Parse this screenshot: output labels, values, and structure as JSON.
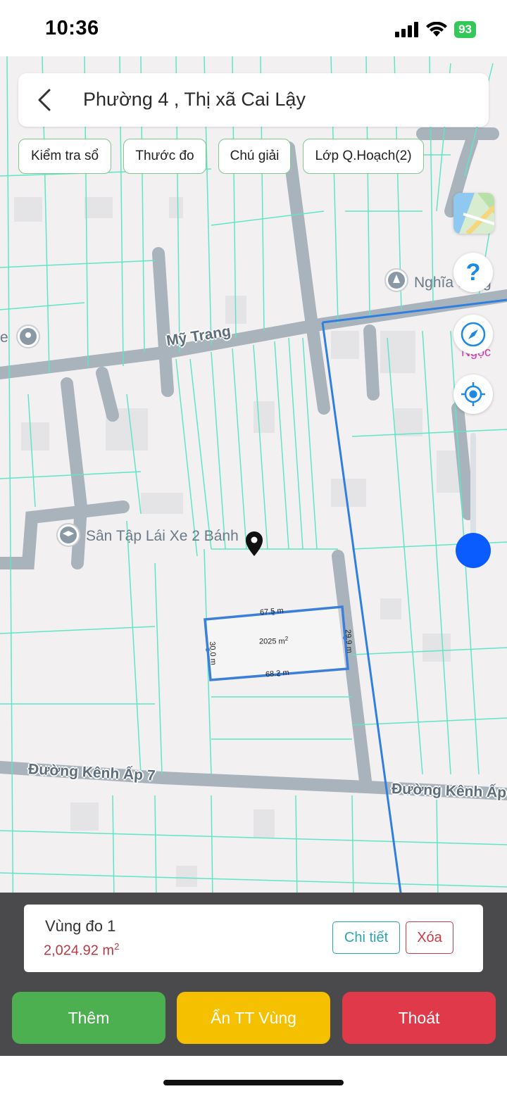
{
  "status_bar": {
    "time": "10:36",
    "battery": "93"
  },
  "header": {
    "title": "Phường 4 , Thị xã Cai Lậy"
  },
  "toolbar": {
    "check_book": "Kiểm tra sổ",
    "ruler": "Thước đo",
    "legend": "Chú giải",
    "planning_layer": "Lớp Q.Hoạch(2)"
  },
  "map": {
    "roads": {
      "my_trang": "Mỹ Trang",
      "kenh_ap_7_left": "Đường Kênh Ấp 7",
      "kenh_ap_7_right": "Đường Kênh Ấp"
    },
    "pois": {
      "driving_school": "Sân Tập Lái Xe 2 Bánh",
      "cemetery": "Nghĩa trang",
      "right_partial": "Ngọc",
      "left_partial": "e"
    },
    "measurement": {
      "top_edge": "67.5 m",
      "bottom_edge": "68.2 m",
      "left_edge": "30.0 m",
      "right_edge": "29.9 m",
      "area_value": "2025 m",
      "area_sup": "2"
    },
    "zoom_level": 0.1
  },
  "zone_card": {
    "name": "Vùng đo 1",
    "area_value": "2,024.92 m",
    "area_sup": "2",
    "detail_label": "Chi tiết",
    "delete_label": "Xóa"
  },
  "actions": {
    "add": "Thêm",
    "hide_info": "Ẩn TT Vùng",
    "exit": "Thoát"
  },
  "colors": {
    "accent_blue": "#0a5cff",
    "parcel_line": "#60e8c8",
    "boundary_line": "#2f7fe0",
    "add_button": "#4caf50",
    "hide_button": "#f5c000",
    "exit_button": "#e03a4a",
    "area_text": "#b73a45"
  }
}
